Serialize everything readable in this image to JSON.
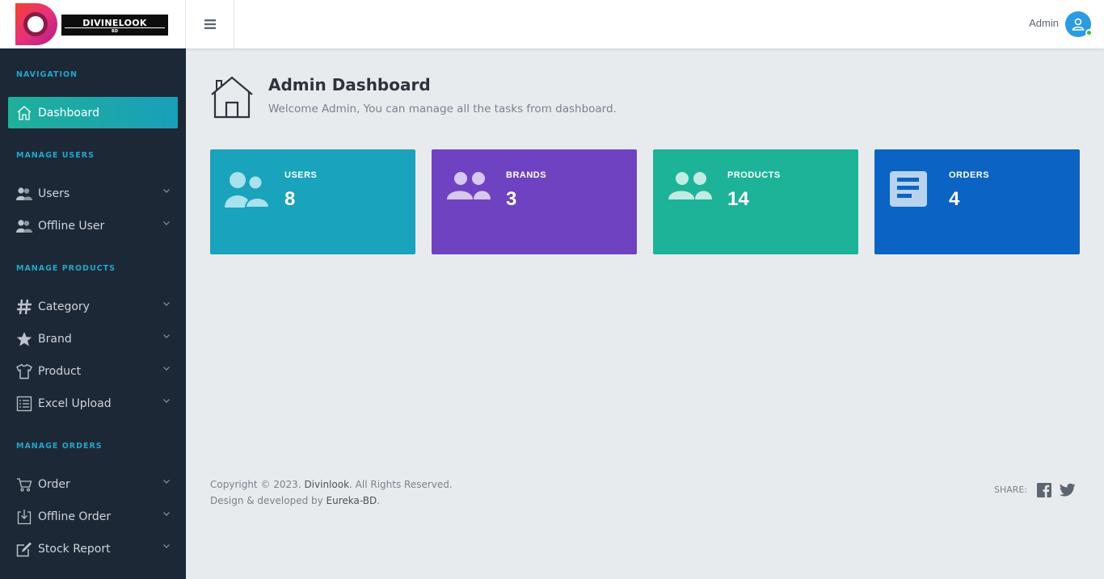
{
  "header": {
    "logo_text": "DIVINELOOK",
    "logo_sub": "BD",
    "admin_name": "Admin"
  },
  "sidebar": {
    "headings": [
      "NAVIGATION",
      "MANAGE USERS",
      "MANAGE PRODUCTS",
      "MANAGE ORDERS"
    ],
    "items": [
      {
        "label": "Dashboard",
        "icon": "home-icon",
        "active": true
      },
      {
        "label": "Users",
        "icon": "users-icon"
      },
      {
        "label": "Offline User",
        "icon": "users-icon"
      },
      {
        "label": "Category",
        "icon": "hashtag-icon"
      },
      {
        "label": "Brand",
        "icon": "star-icon"
      },
      {
        "label": "Product",
        "icon": "tshirt-icon"
      },
      {
        "label": "Excel Upload",
        "icon": "list-icon"
      },
      {
        "label": "Order",
        "icon": "cart-icon"
      },
      {
        "label": "Offline Order",
        "icon": "download-icon"
      },
      {
        "label": "Stock Report",
        "icon": "edit-icon"
      }
    ]
  },
  "main": {
    "title": "Admin Dashboard",
    "subtitle": "Welcome Admin, You can manage all the tasks from dashboard."
  },
  "cards": [
    {
      "label": "USERS",
      "value": "8",
      "color": "#19a3bc",
      "icon": "users-icon"
    },
    {
      "label": "BRANDS",
      "value": "3",
      "color": "#6f42c1",
      "icon": "group-icon"
    },
    {
      "label": "PRODUCTS",
      "value": "14",
      "color": "#1db399",
      "icon": "group-icon"
    },
    {
      "label": "ORDERS",
      "value": "4",
      "color": "#0b63c4",
      "icon": "document-icon"
    }
  ],
  "footer": {
    "copy_prefix": "Copyright © 2023. ",
    "brand": "Divinlook",
    "copy_suffix": ". All Rights Reserved.",
    "dev_prefix": "Design & developed by ",
    "developer": "Eureka-BD",
    "dev_suffix": ".",
    "share_label": "SHARE:"
  },
  "colors": {
    "sidebar_bg": "#1d2837",
    "accent": "#23a7c9",
    "active_start": "#1fb09a",
    "active_end": "#1a9fb9"
  }
}
